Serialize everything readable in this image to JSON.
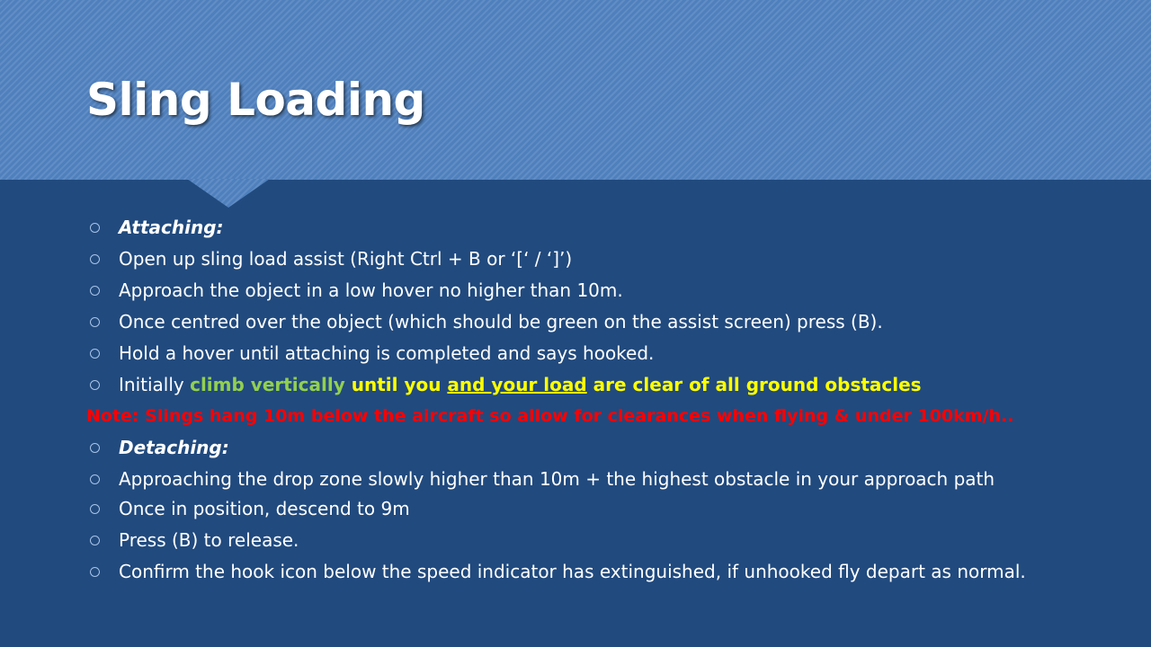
{
  "slide": {
    "title": "Sling Loading",
    "attaching": {
      "heading": "Attaching:",
      "items": [
        "Open up sling load assist (Right Ctrl + B or ‘[‘ / ‘]’)",
        "Approach the object in a low hover no higher than 10m.",
        "Once centred over the object (which should be green on the assist screen) press (B).",
        "Hold a hover until attaching is completed and says hooked."
      ],
      "climb": {
        "lead": "Initially ",
        "green": "climb vertically",
        "yellow1": " until you ",
        "underlined": "and your load",
        "yellow2": " are clear of all ground obstacles"
      }
    },
    "note": "Note: Slings hang 10m below the aircraft so allow for clearances when flying & under 100km/h..",
    "detaching": {
      "heading": "Detaching:",
      "items": [
        "Approaching the drop zone slowly higher than 10m + the highest obstacle in your approach path",
        "Once in position, descend to 9m",
        "Press (B) to release.",
        "Confirm the hook icon below the speed indicator has extinguished, if unhooked fly depart as normal."
      ]
    }
  },
  "colors": {
    "background": "#214a7e",
    "header": "#4f80bd",
    "highlight_green": "#92d050",
    "highlight_yellow": "#ffff00",
    "note_red": "#ff0000"
  },
  "icons": {
    "bullet": "hollow-circle-bullet-icon"
  }
}
